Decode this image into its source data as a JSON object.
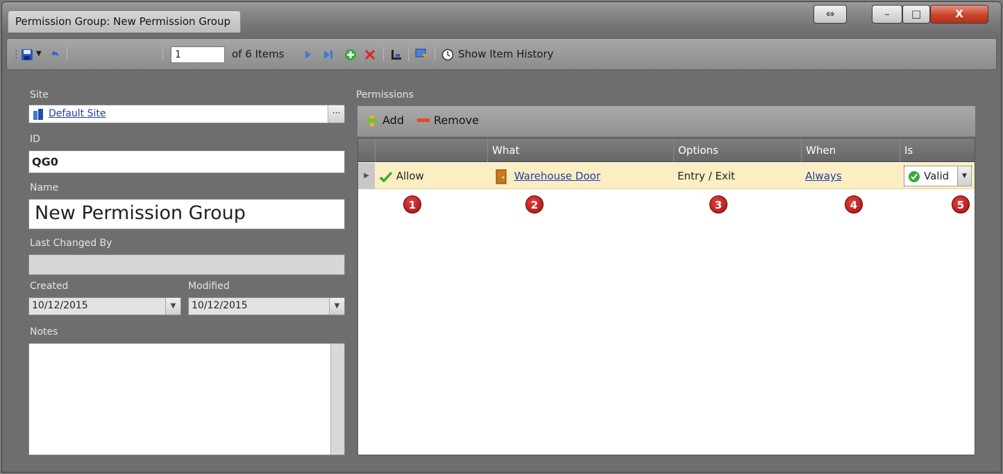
{
  "window": {
    "title": "Permission Group: New Permission Group",
    "resize_glyph": "⇔",
    "minimize_glyph": "–",
    "maximize_glyph": "□",
    "close_glyph": "X"
  },
  "toolbar": {
    "position_value": "1",
    "item_count": "of 6 Items",
    "show_history": "Show Item History"
  },
  "form": {
    "site_label": "Site",
    "site_value": "Default Site",
    "site_browse": "···",
    "id_label": "ID",
    "id_value": "QG0",
    "name_label": "Name",
    "name_value": "New Permission Group",
    "last_changed_label": "Last Changed By",
    "last_changed_value": "",
    "created_label": "Created",
    "created_value": "10/12/2015",
    "modified_label": "Modified",
    "modified_value": "10/12/2015",
    "notes_label": "Notes",
    "notes_value": ""
  },
  "permissions": {
    "section_label": "Permissions",
    "add_label": "Add",
    "remove_label": "Remove",
    "columns": [
      "What",
      "Options",
      "When",
      "Is"
    ],
    "rows": [
      {
        "allow": "Allow",
        "what": "Warehouse Door",
        "options": "Entry / Exit",
        "when": "Always",
        "is": "Valid"
      }
    ]
  },
  "callouts": [
    "1",
    "2",
    "3",
    "4",
    "5"
  ],
  "colors": {
    "row_highlight": "#fbeec2",
    "link": "#1f3fa8",
    "callout": "#c21a1a"
  }
}
